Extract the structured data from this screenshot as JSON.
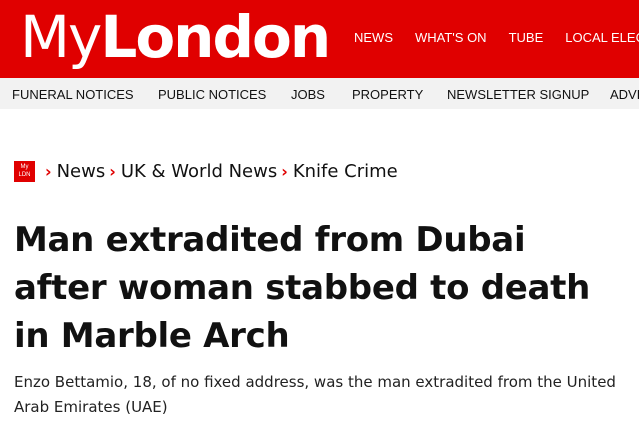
{
  "brand": {
    "logo_part1": "My",
    "logo_part2": "London",
    "mini_logo_line1": "My",
    "mini_logo_line2": "LDN",
    "accent_color": "#e00000"
  },
  "main_nav": [
    "NEWS",
    "WHAT'S ON",
    "TUBE",
    "LOCAL ELEC"
  ],
  "sub_nav": [
    "FUNERAL NOTICES",
    "PUBLIC NOTICES",
    "JOBS",
    "PROPERTY",
    "NEWSLETTER SIGNUP",
    "ADVE"
  ],
  "breadcrumb": [
    "News",
    "UK & World News",
    "Knife Crime"
  ],
  "icons": {
    "breadcrumb_separator": "chevron-right-icon"
  },
  "article": {
    "headline": "Man extradited from Dubai after woman stabbed to death in Marble Arch",
    "standfirst": "Enzo Bettamio, 18, of no fixed address, was the man extradited from the United Arab Emirates (UAE)"
  }
}
